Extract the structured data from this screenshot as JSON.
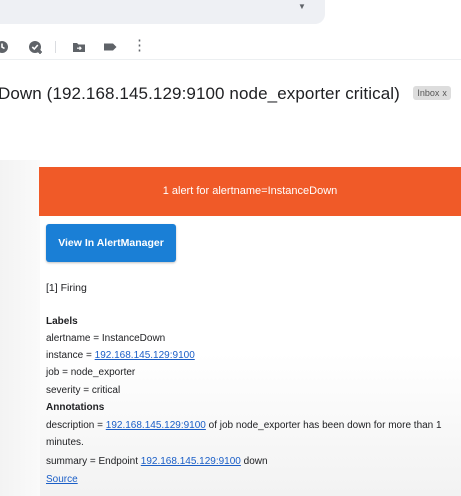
{
  "toolbar": {
    "icons": [
      "snooze-icon",
      "add-to-tasks-icon",
      "move-to-folder-icon",
      "label-icon",
      "more-options-icon"
    ],
    "more_glyph": "⋮"
  },
  "search": {
    "caret": "▼"
  },
  "email": {
    "subject": "Down (192.168.145.129:9100 node_exporter critical)",
    "label_chip": "Inbox",
    "label_chip_close": "x",
    "alert_header": "1 alert for alertname=InstanceDown",
    "view_button": "View In AlertManager",
    "firing": "[1] Firing",
    "labels_heading": "Labels",
    "labels": {
      "alertname": "alertname = InstanceDown",
      "instance_prefix": "instance = ",
      "instance_link": "192.168.145.129:9100",
      "job": "job = node_exporter",
      "severity": "severity = critical"
    },
    "annotations_heading": "Annotations",
    "annotations": {
      "description_prefix": "description = ",
      "description_link": "192.168.145.129:9100",
      "description_suffix": " of job node_exporter has been down for more than 1",
      "description_cont": "minutes.",
      "summary_prefix": "summary = Endpoint ",
      "summary_link": "192.168.145.129:9100",
      "summary_suffix": " down"
    },
    "source_link": "Source"
  },
  "colors": {
    "alert_header_bg": "#f05a28",
    "button_bg": "#1a7fd6",
    "link": "#1a5ec7"
  }
}
